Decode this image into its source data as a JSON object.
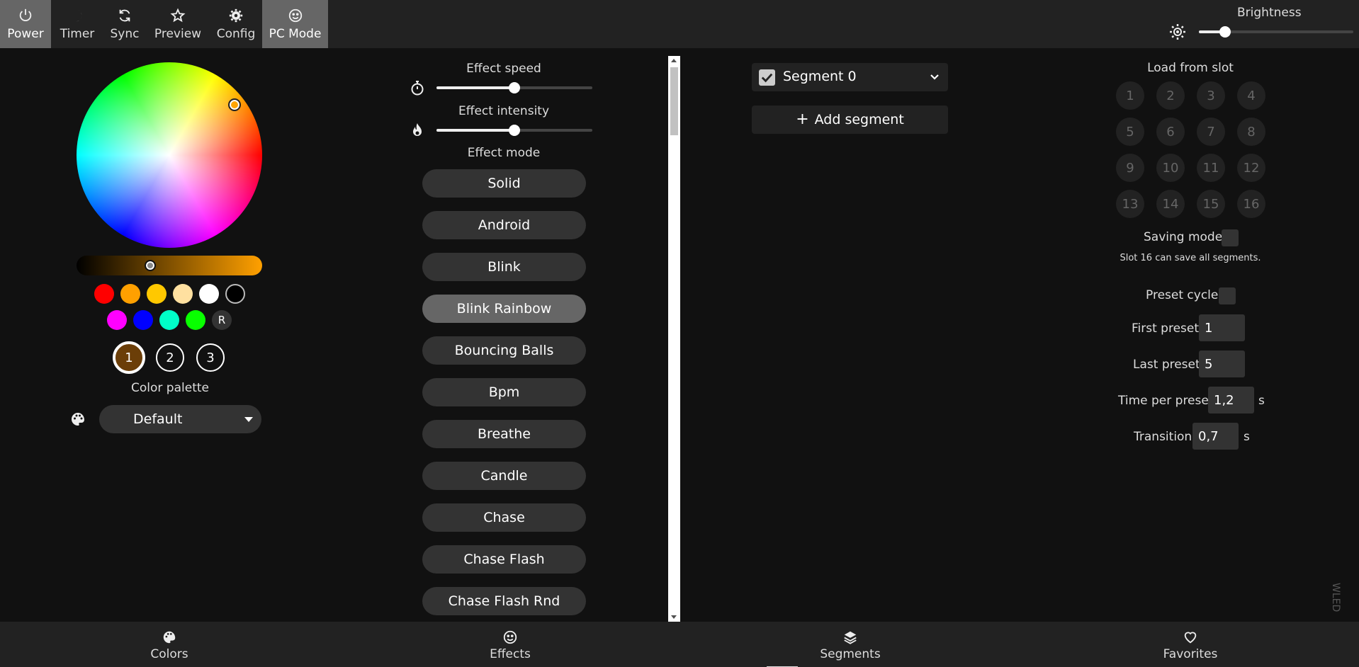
{
  "topbar": {
    "buttons": [
      {
        "label": "Power",
        "icon": "power-icon",
        "active": true
      },
      {
        "label": "Timer",
        "icon": "moon-icon",
        "active": false
      },
      {
        "label": "Sync",
        "icon": "sync-icon",
        "active": false
      },
      {
        "label": "Preview",
        "icon": "star-icon",
        "active": false
      },
      {
        "label": "Config",
        "icon": "gear-icon",
        "active": false
      },
      {
        "label": "PC Mode",
        "icon": "smiley-icon",
        "active": true
      }
    ],
    "brightness_label": "Brightness",
    "brightness_value": 0.17
  },
  "colors": {
    "wheel_hue_color": "#ffa500",
    "value_gradient": [
      "#000000",
      "#ffa000"
    ],
    "quick_colors_row1": [
      "#ff0000",
      "#ffa000",
      "#ffc800",
      "#ffe0a0",
      "#ffffff",
      "#000000"
    ],
    "quick_colors_row2": [
      "#ff00ff",
      "#0000ff",
      "#00ffc8",
      "#08ff00"
    ],
    "random_label": "R",
    "slots": [
      "1",
      "2",
      "3"
    ],
    "selected_slot_color": "#6b3e08",
    "palette_label": "Color palette",
    "palette_value": "Default"
  },
  "effects": {
    "speed_label": "Effect speed",
    "speed_value": 0.5,
    "intensity_label": "Effect intensity",
    "intensity_value": 0.5,
    "mode_label": "Effect mode",
    "modes": [
      "Solid",
      "Android",
      "Blink",
      "Blink Rainbow",
      "Bouncing Balls",
      "Bpm",
      "Breathe",
      "Candle",
      "Chase",
      "Chase Flash",
      "Chase Flash Rnd"
    ],
    "active_mode": "Blink Rainbow"
  },
  "segments": {
    "segment_name": "Segment 0",
    "add_label": "Add segment"
  },
  "favorites": {
    "load_label": "Load from slot",
    "slots": [
      "1",
      "2",
      "3",
      "4",
      "5",
      "6",
      "7",
      "8",
      "9",
      "10",
      "11",
      "12",
      "13",
      "14",
      "15",
      "16"
    ],
    "saving_mode_label": "Saving mode",
    "slot_note": "Slot 16 can save all segments.",
    "preset_cycle_label": "Preset cycle",
    "first_preset_label": "First preset:",
    "first_preset_value": "1",
    "last_preset_label": "Last preset:",
    "last_preset_value": "5",
    "time_per_preset_label": "Time per preset:",
    "time_per_preset_value": "1,2",
    "transition_label": "Transition:",
    "transition_value": "0,7",
    "unit_s": "s"
  },
  "watermark": "WLED",
  "bottom_nav": [
    {
      "label": "Colors",
      "icon": "palette-icon"
    },
    {
      "label": "Effects",
      "icon": "smiley-icon"
    },
    {
      "label": "Segments",
      "icon": "layers-icon"
    },
    {
      "label": "Favorites",
      "icon": "heart-icon"
    }
  ]
}
